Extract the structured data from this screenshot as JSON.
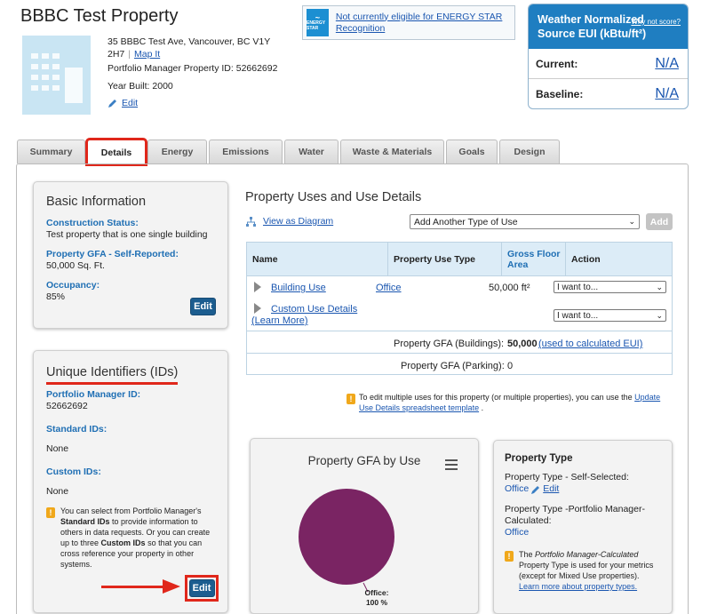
{
  "header": {
    "title": "BBBC Test Property",
    "address": "35 BBBC Test Ave, Vancouver, BC V1Y 2H7",
    "map_link": "Map It",
    "pm_id_text": "Portfolio Manager Property ID: 52662692",
    "year_built_text": "Year Built: 2000",
    "edit_link": "Edit"
  },
  "energy_star": {
    "logo_text": "ENERGY STAR",
    "message": "Not currently eligible for ENERGY STAR Recognition"
  },
  "eui": {
    "title": "Weather Normalized Source EUI (kBtu/ft²)",
    "why_link": "Why not score?",
    "rows": [
      {
        "label": "Current:",
        "value": "N/A"
      },
      {
        "label": "Baseline:",
        "value": "N/A"
      }
    ]
  },
  "tabs": [
    {
      "label": "Summary",
      "active": false
    },
    {
      "label": "Details",
      "active": true
    },
    {
      "label": "Energy",
      "active": false
    },
    {
      "label": "Emissions",
      "active": false
    },
    {
      "label": "Water",
      "active": false
    },
    {
      "label": "Waste & Materials",
      "active": false
    },
    {
      "label": "Goals",
      "active": false
    },
    {
      "label": "Design",
      "active": false
    }
  ],
  "basic_info": {
    "title": "Basic Information",
    "construction_label": "Construction Status:",
    "construction_value": "Test property that is one single building",
    "gfa_label": "Property GFA - Self-Reported:",
    "gfa_value": "50,000 Sq. Ft.",
    "occupancy_label": "Occupancy:",
    "occupancy_value": "85%",
    "edit_button": "Edit"
  },
  "unique_ids": {
    "title": "Unique Identifiers (IDs)",
    "pm_id_label": "Portfolio Manager ID:",
    "pm_id_value": "52662692",
    "standard_label": "Standard IDs:",
    "standard_value": "None",
    "custom_label": "Custom IDs:",
    "custom_value": "None",
    "note_part1": "You can select from Portfolio Manager's ",
    "note_bold1": "Standard IDs",
    "note_part2": " to provide information to others in data requests. Or you can create up to three ",
    "note_bold2": "Custom IDs",
    "note_part3": " so that you can cross reference your property in other systems.",
    "edit_button": "Edit"
  },
  "uses": {
    "title": "Property Uses and Use Details",
    "view_diagram": "View as Diagram",
    "add_select": "Add Another Type of Use",
    "add_button": "Add",
    "columns": [
      "Name",
      "Property Use Type",
      "Gross Floor Area",
      "Action"
    ],
    "rows": [
      {
        "name": "Building Use",
        "type": "Office",
        "gfa": "50,000 ft²",
        "action": "I want to..."
      },
      {
        "name": "Custom Use Details",
        "extra": "(Learn More)",
        "type": "",
        "gfa": "",
        "action": "I want to..."
      }
    ],
    "totals": [
      {
        "label": "Property GFA (Buildings):",
        "value": "50,000",
        "link": "(used to calculated EUI)"
      },
      {
        "label": "Property GFA (Parking):",
        "value": "0",
        "link": ""
      }
    ],
    "tip_text": "To edit multiple uses for this property (or multiple properties), you can use the ",
    "tip_link": "Update Use Details spreadsheet template",
    "tip_end": " ."
  },
  "chart_data": {
    "type": "pie",
    "title": "Property GFA by Use",
    "categories": [
      "Office"
    ],
    "values": [
      100
    ],
    "data_labels": [
      "Office:",
      "100 %"
    ],
    "colors": [
      "#7a2463"
    ]
  },
  "property_type": {
    "title": "Property Type",
    "self_label": "Property Type - Self-Selected:",
    "self_value": "Office",
    "edit_link": "Edit",
    "pm_label": "Property Type -Portfolio Manager-Calculated:",
    "pm_value": "Office",
    "note_pre": "The ",
    "note_italic": "Portfolio Manager-Calculated",
    "note_post": " Property Type is used for your metrics (except for Mixed Use properties). ",
    "note_link": "Learn more about property types."
  },
  "colors": {
    "accent": "#1f7ec1",
    "highlight": "#e0271b",
    "pie": "#7a2463"
  }
}
